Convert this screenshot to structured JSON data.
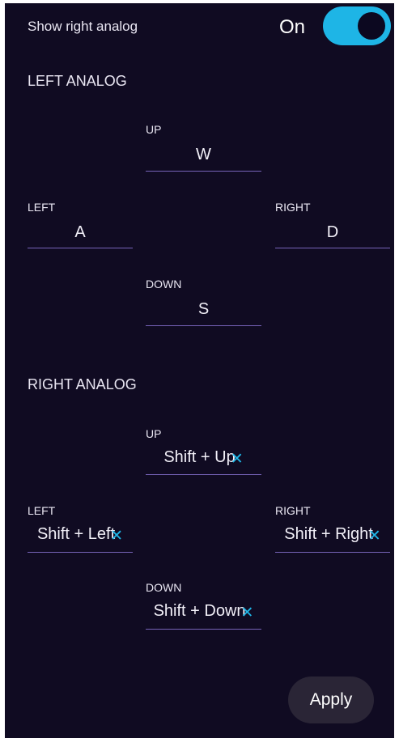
{
  "toggle": {
    "label": "Show right analog",
    "state": "On",
    "on": true,
    "accent": "#1eb5e6"
  },
  "left_analog": {
    "title": "LEFT ANALOG",
    "up": {
      "label": "UP",
      "value": "W"
    },
    "left": {
      "label": "LEFT",
      "value": "A"
    },
    "right": {
      "label": "RIGHT",
      "value": "D"
    },
    "down": {
      "label": "DOWN",
      "value": "S"
    }
  },
  "right_analog": {
    "title": "RIGHT ANALOG",
    "up": {
      "label": "UP",
      "value": "Shift + Up"
    },
    "left": {
      "label": "LEFT",
      "value": "Shift + Left"
    },
    "right": {
      "label": "RIGHT",
      "value": "Shift + Right"
    },
    "down": {
      "label": "DOWN",
      "value": "Shift + Down"
    },
    "clear_icon": "close-icon"
  },
  "apply_label": "Apply",
  "colors": {
    "background": "#100b22",
    "underline": "#7663b8",
    "button_bg": "#2a2536"
  }
}
